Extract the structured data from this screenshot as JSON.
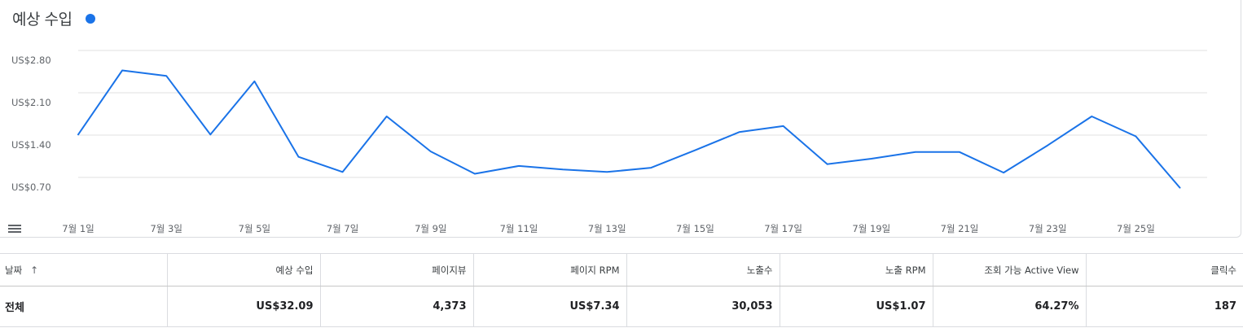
{
  "chart_data": {
    "type": "line",
    "title": "예상 수입",
    "series_color": "#1a73e8",
    "y_ticks": [
      "US$2.80",
      "US$2.10",
      "US$1.40",
      "US$0.70"
    ],
    "y_tick_values": [
      2.8,
      2.1,
      1.4,
      0.7
    ],
    "ylim": [
      0.35,
      2.8
    ],
    "x_ticks": [
      "7월 1일",
      "7월 3일",
      "7월 5일",
      "7월 7일",
      "7월 9일",
      "7월 11일",
      "7월 13일",
      "7월 15일",
      "7월 17일",
      "7월 19일",
      "7월 21일",
      "7월 23일",
      "7월 25일"
    ],
    "x": [
      "7월 1일",
      "7월 2일",
      "7월 3일",
      "7월 4일",
      "7월 5일",
      "7월 6일",
      "7월 7일",
      "7월 8일",
      "7월 9일",
      "7월 10일",
      "7월 11일",
      "7월 12일",
      "7월 13일",
      "7월 14일",
      "7월 15일",
      "7월 16일",
      "7월 17일",
      "7월 18일",
      "7월 19일",
      "7월 20일",
      "7월 21일",
      "7월 22일",
      "7월 23일",
      "7월 24일",
      "7월 25일",
      "7월 26일"
    ],
    "values": [
      1.41,
      2.47,
      2.38,
      1.41,
      2.29,
      1.04,
      0.79,
      1.71,
      1.13,
      0.76,
      0.89,
      0.83,
      0.79,
      0.86,
      1.15,
      1.45,
      1.55,
      0.92,
      1.01,
      1.12,
      1.12,
      0.78,
      1.23,
      1.71,
      1.38,
      0.53
    ],
    "grid": true
  },
  "table": {
    "sort_icon": "arrow-up-icon",
    "headers": [
      "날짜",
      "예상 수입",
      "페이지뷰",
      "페이지 RPM",
      "노출수",
      "노출 RPM",
      "조회 가능 Active View",
      "클릭수"
    ],
    "total_row": [
      "전체",
      "US$32.09",
      "4,373",
      "US$7.34",
      "30,053",
      "US$1.07",
      "64.27%",
      "187"
    ]
  }
}
